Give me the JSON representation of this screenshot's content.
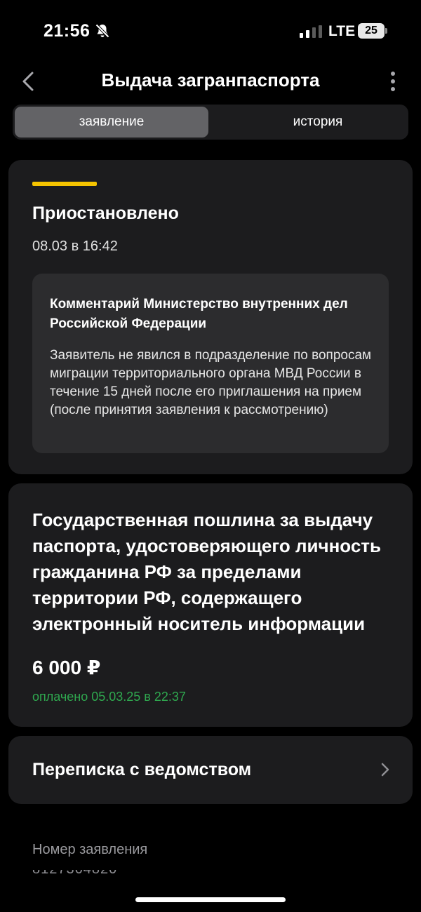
{
  "status_bar": {
    "time": "21:56",
    "network": "LTE",
    "battery": "25",
    "icons": [
      "bell-slash-icon",
      "signal-icon",
      "battery-icon"
    ]
  },
  "header": {
    "title": "Выдача загранпаспорта",
    "icons": [
      "chevron-left-icon",
      "more-vertical-icon"
    ]
  },
  "tabs": [
    {
      "label": "заявление",
      "active": true
    },
    {
      "label": "история",
      "active": false
    }
  ],
  "status_card": {
    "status": "Приостановлено",
    "date": "08.03 в 16:42",
    "accent_color": "#f5c400",
    "comment": {
      "title": "Комментарий Министерство внутренних дел Российской Федерации",
      "text": "Заявитель не явился в подразделение по вопросам миграции территориального органа МВД России в течение 15 дней после его приглашения на прием (после принятия заявления к рассмотрению)"
    }
  },
  "fee_card": {
    "title": "Государственная пошлина за выдачу паспорта, удостоверяющего личность гражданина РФ за пределами территории РФ, содержащего электронный носитель информации",
    "amount": "6 000 ₽",
    "paid": "оплачено 05.03.25 в 22:37",
    "paid_color": "#2fa84f"
  },
  "correspondence": {
    "label": "Переписка с ведомством",
    "icon": "chevron-right-icon"
  },
  "application": {
    "label": "Номер заявления"
  }
}
